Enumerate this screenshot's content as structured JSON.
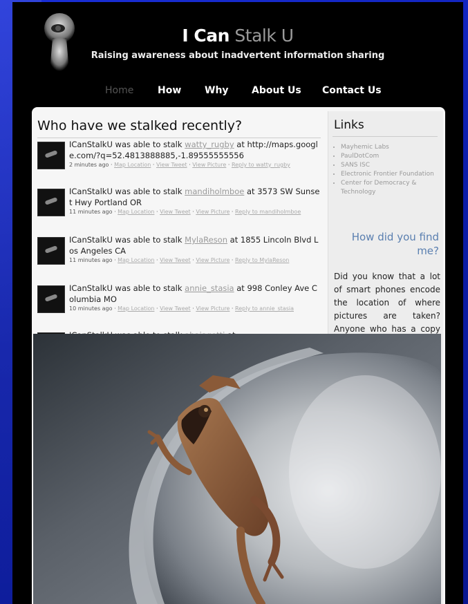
{
  "site": {
    "title_bold": "I Can",
    "title_light": " Stalk U",
    "tagline": "Raising awareness about inadvertent information sharing"
  },
  "nav": [
    "Home",
    "How",
    "Why",
    "About Us",
    "Contact Us"
  ],
  "main": {
    "heading": "Who have we stalked recently?",
    "entries": [
      {
        "prefix": "ICanStalkU was able to stalk ",
        "user": "watty_rugby",
        "suffix": " at http://maps.google.com/?q=52.4813888885,-1.89555555556",
        "time": "2 minutes ago",
        "links": [
          "Map Location",
          "View Tweet",
          "View Picture",
          "Reply to watty_rugby"
        ]
      },
      {
        "prefix": "ICanStalkU was able to stalk ",
        "user": "mandiholmboe",
        "suffix": " at 3573 SW Sunset Hwy Portland OR",
        "time": "11 minutes ago",
        "links": [
          "Map Location",
          "View Tweet",
          "View Picture",
          "Reply to mandiholmboe"
        ]
      },
      {
        "prefix": "ICanStalkU was able to stalk ",
        "user": "MylaReson",
        "suffix": " at 1855 Lincoln Blvd Los Angeles CA",
        "time": "11 minutes ago",
        "links": [
          "Map Location",
          "View Tweet",
          "View Picture",
          "Reply to MylaReson"
        ]
      },
      {
        "prefix": "ICanStalkU was able to stalk ",
        "user": "annie_stasia",
        "suffix": " at 998 Conley Ave Columbia MO",
        "time": "10 minutes ago",
        "links": [
          "Map Location",
          "View Tweet",
          "View Picture",
          "Reply to annie_stasia"
        ]
      },
      {
        "prefix": "ICanStalkU was able to stalk ",
        "user": "abaiagotti",
        "suffix": " at",
        "time": "",
        "links": []
      }
    ]
  },
  "sidebar": {
    "heading": "Links",
    "links": [
      "Mayhemic Labs",
      "PaulDotCom",
      "SANS ISC",
      "Electronic Frontier Foundation",
      "Center for Democracy & Technology"
    ],
    "question": "How did you find me?",
    "body": "Did you know that a lot of smart phones encode the location of where pictures are taken? Anyone who has a copy can access this"
  },
  "icons": {
    "logo": "keyhole-eye-icon",
    "thumb": "tweet-photo-thumbnail"
  },
  "colors": {
    "slide_bg": "#1028c8",
    "site_bg": "#000000",
    "panel_bg": "#f6f6f6",
    "accent": "#5a7fb0"
  }
}
